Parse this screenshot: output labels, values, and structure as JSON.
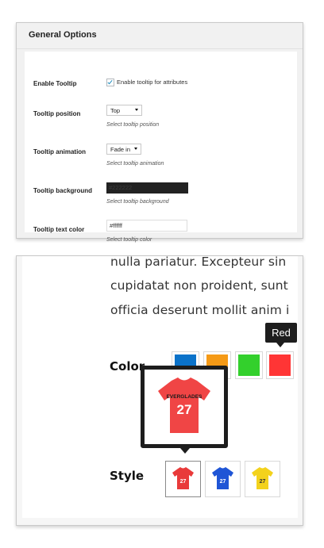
{
  "general_options": {
    "title": "General Options",
    "enable_tooltip": {
      "label": "Enable Tooltip",
      "checkbox_label": "Enable tooltip for attributes",
      "checked": true
    },
    "tooltip_position": {
      "label": "Tooltip position",
      "value": "Top",
      "description": "Select tooltip position"
    },
    "tooltip_animation": {
      "label": "Tooltip animation",
      "value": "Fade in",
      "description": "Select tooltip animation"
    },
    "tooltip_background": {
      "label": "Tooltip background",
      "value": "#222222",
      "description": "Select tooltip background"
    },
    "tooltip_text_color": {
      "label": "Tooltip text color",
      "value": "#ffffff",
      "description": "Select tooltip color"
    }
  },
  "preview": {
    "text_lines": [
      "nulla pariatur. Excepteur sin",
      "cupidatat non proident, sunt",
      "officia deserunt mollit anim i"
    ],
    "color_attribute": {
      "label": "Color",
      "swatches": [
        {
          "name": "blue",
          "color": "#0a72c9"
        },
        {
          "name": "orange",
          "color": "#f59a16"
        },
        {
          "name": "green",
          "color": "#33d02c"
        },
        {
          "name": "red",
          "color": "#ff3535"
        }
      ],
      "tooltip_text": "Red"
    },
    "style_attribute": {
      "label": "Style",
      "swatches": [
        {
          "name": "red-shirt",
          "color": "#e93a3a",
          "selected": true
        },
        {
          "name": "blue-shirt",
          "color": "#1f55d6",
          "selected": false
        },
        {
          "name": "yellow-shirt",
          "color": "#f3d21c",
          "selected": false
        }
      ],
      "tooltip_image": {
        "shirt_text_top": "EVERGLADES",
        "shirt_number": "27",
        "shirt_color": "#f04545"
      }
    }
  }
}
